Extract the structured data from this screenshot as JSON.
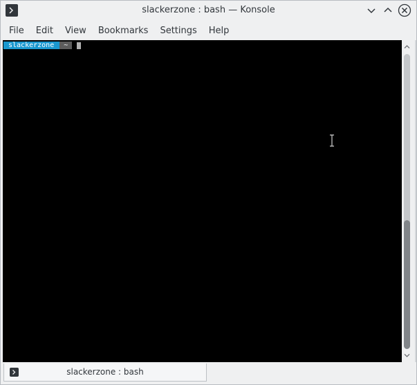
{
  "window": {
    "title": "slackerzone : bash — Konsole",
    "app_icon": "terminal-icon"
  },
  "menu": {
    "items": [
      {
        "label": "File"
      },
      {
        "label": "Edit"
      },
      {
        "label": "View"
      },
      {
        "label": "Bookmarks"
      },
      {
        "label": "Settings"
      },
      {
        "label": "Help"
      }
    ]
  },
  "terminal": {
    "prompt_user": "slackerzone",
    "prompt_dir": "~",
    "colors": {
      "background": "#000000",
      "user_segment": "#1a98cf",
      "dir_segment": "#5c5c5c"
    }
  },
  "tabs": [
    {
      "label": "slackerzone : bash",
      "icon": "terminal-icon"
    }
  ]
}
